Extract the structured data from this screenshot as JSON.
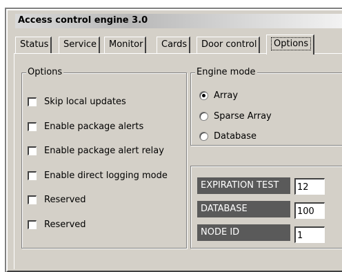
{
  "window": {
    "title": "Access control engine 3.0"
  },
  "tabs": [
    {
      "label": "Status"
    },
    {
      "label": "Service"
    },
    {
      "label": "Monitor"
    },
    {
      "label": "Cards"
    },
    {
      "label": "Door control"
    },
    {
      "label": "Options",
      "active": true
    }
  ],
  "options_group": {
    "title": "Options",
    "checkboxes": [
      {
        "label": "Skip local updates",
        "checked": false
      },
      {
        "label": "Enable package alerts",
        "checked": false
      },
      {
        "label": "Enable package alert relay",
        "checked": false
      },
      {
        "label": "Enable direct logging mode",
        "checked": false
      },
      {
        "label": "Reserved",
        "checked": false
      },
      {
        "label": "Reserved",
        "checked": false
      }
    ]
  },
  "engine_mode": {
    "title": "Engine mode",
    "options": [
      {
        "label": "Array",
        "selected": true
      },
      {
        "label": "Sparse Array",
        "selected": false
      },
      {
        "label": "Database",
        "selected": false
      }
    ]
  },
  "fields": [
    {
      "label": "EXPIRATION TEST",
      "value": "12"
    },
    {
      "label": "DATABASE",
      "value": "100"
    },
    {
      "label": "NODE ID",
      "value": "1"
    }
  ]
}
